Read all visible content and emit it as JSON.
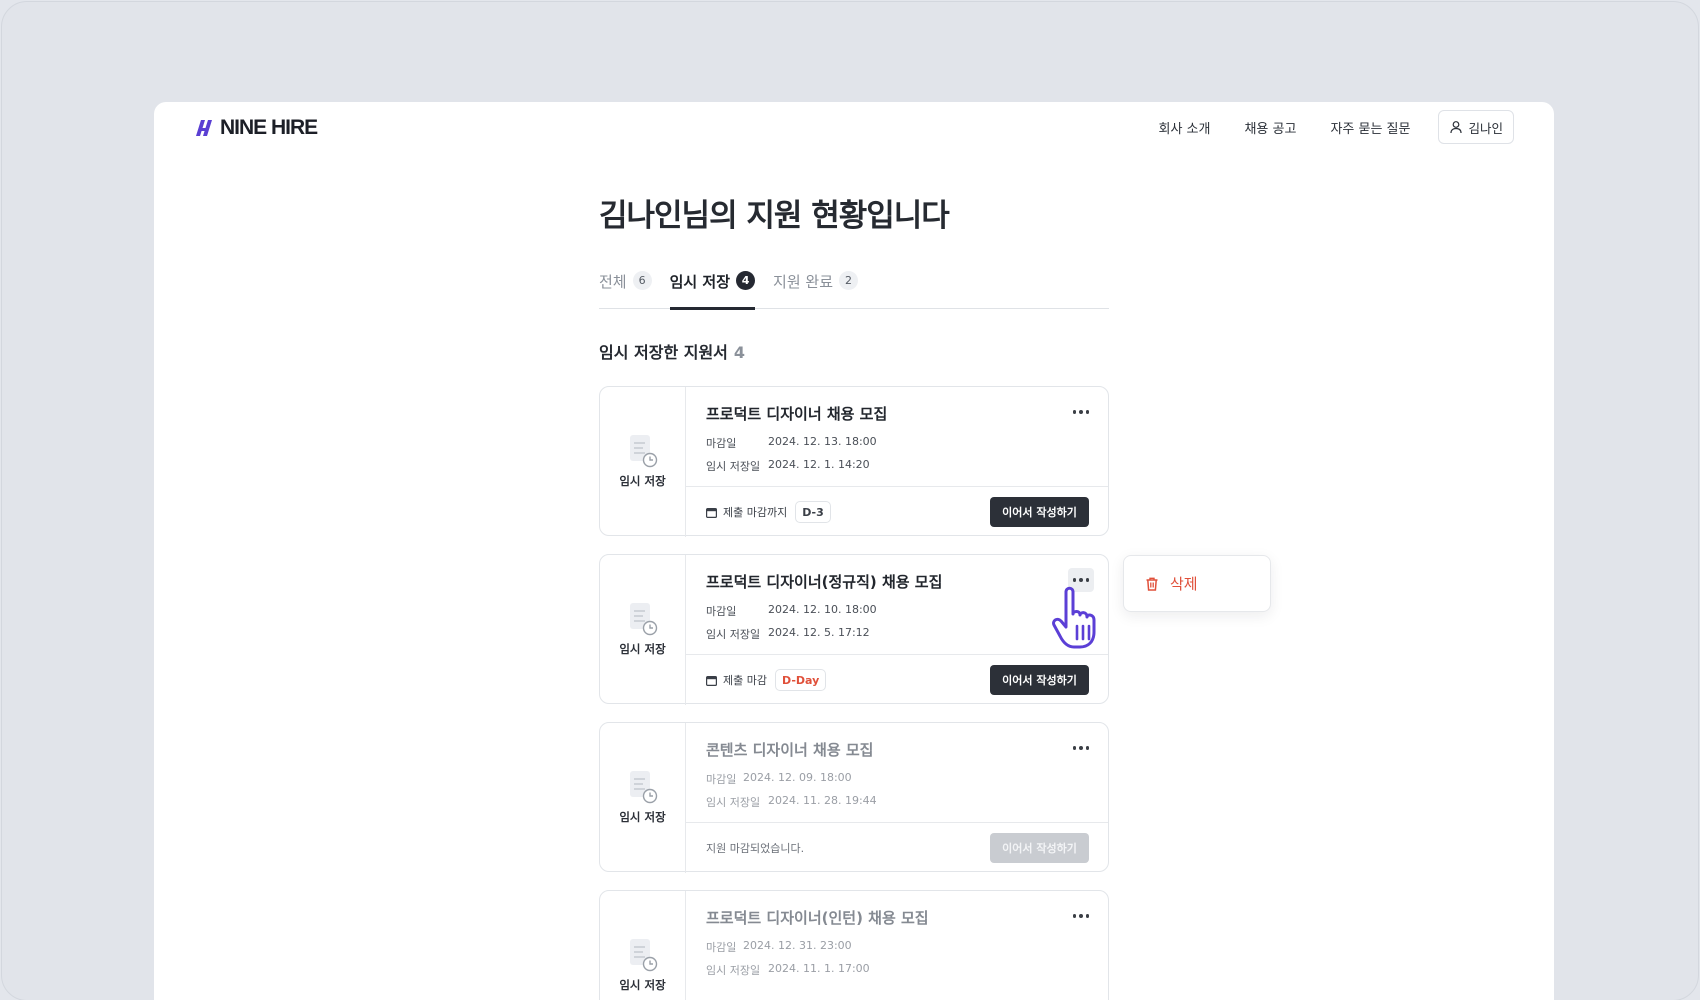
{
  "header": {
    "logo_text": "NINE HIRE",
    "nav": [
      "회사 소개",
      "채용 공고",
      "자주 묻는 질문"
    ],
    "user_name": "김나인"
  },
  "page_title": "김나인님의 지원 현황입니다",
  "tabs": [
    {
      "label": "전체",
      "count": "6",
      "active": false
    },
    {
      "label": "임시 저장",
      "count": "4",
      "active": true
    },
    {
      "label": "지원 완료",
      "count": "2",
      "active": false
    }
  ],
  "section": {
    "title": "임시 저장한 지원서",
    "count": "4"
  },
  "cards": [
    {
      "side_label": "임시 저장",
      "title": "프로덕트 디자이너 채용 모집",
      "deadline_label": "마감일",
      "deadline": "2024. 12. 13. 18:00",
      "saved_label": "임시 저장일",
      "saved": "2024. 12. 1. 14:20",
      "footer_text": "제출 마감까지",
      "badge": "D-3",
      "cta": "이어서 작성하기"
    },
    {
      "side_label": "임시 저장",
      "title": "프로덕트 디자이너(정규직) 채용 모집",
      "deadline_label": "마감일",
      "deadline": "2024. 12. 10. 18:00",
      "saved_label": "임시 저장일",
      "saved": "2024. 12. 5. 17:12",
      "footer_text": "제출 마감",
      "badge": "D-Day",
      "cta": "이어서 작성하기"
    },
    {
      "side_label": "임시 저장",
      "title": "콘텐츠 디자이너 채용 모집",
      "deadline_label": "마감일",
      "deadline": "2024. 12. 09. 18:00",
      "saved_label": "임시 저장일",
      "saved": "2024. 11. 28. 19:44",
      "footer_text": "지원 마감되었습니다.",
      "cta": "이어서 작성하기"
    },
    {
      "side_label": "임시 저장",
      "title": "프로덕트 디자이너(인턴) 채용 모집",
      "deadline_label": "마감일",
      "deadline": "2024. 12. 31. 23:00",
      "saved_label": "임시 저장일",
      "saved": "2024. 11. 1. 17:00"
    }
  ],
  "popover": {
    "delete_label": "삭제"
  },
  "colors": {
    "accent_dark": "#252932",
    "danger": "#e0503a",
    "cursor_purple": "#5b3fd6"
  }
}
